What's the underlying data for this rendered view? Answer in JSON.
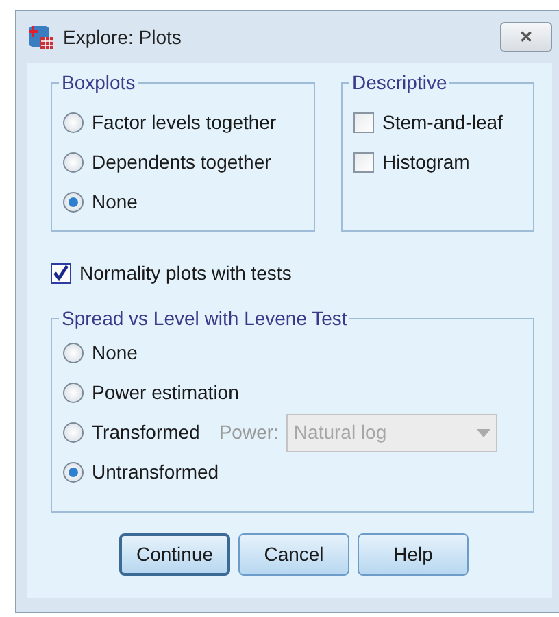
{
  "window": {
    "title": "Explore: Plots",
    "close": "✕"
  },
  "boxplots": {
    "title": "Boxplots",
    "options": [
      {
        "label": "Factor levels together",
        "selected": false
      },
      {
        "label": "Dependents together",
        "selected": false
      },
      {
        "label": "None",
        "selected": true
      }
    ]
  },
  "descriptive": {
    "title": "Descriptive",
    "options": [
      {
        "label": "Stem-and-leaf",
        "checked": false
      },
      {
        "label": "Histogram",
        "checked": false
      }
    ]
  },
  "normality": {
    "label": "Normality plots with tests",
    "checked": true
  },
  "spread": {
    "title": "Spread vs Level with Levene Test",
    "options": [
      {
        "label": "None",
        "selected": false
      },
      {
        "label": "Power estimation",
        "selected": false
      },
      {
        "label": "Transformed",
        "selected": false
      },
      {
        "label": "Untransformed",
        "selected": true
      }
    ],
    "power": {
      "label": "Power:",
      "value": "Natural log",
      "disabled": true
    }
  },
  "buttons": [
    {
      "label": "Continue",
      "default": true
    },
    {
      "label": "Cancel",
      "default": false
    },
    {
      "label": "Help",
      "default": false
    }
  ]
}
